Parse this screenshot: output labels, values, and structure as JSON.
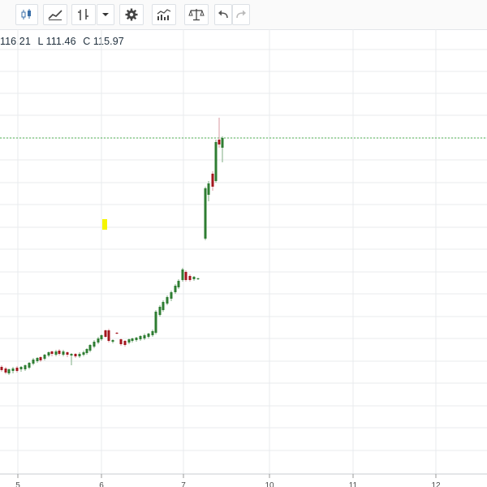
{
  "toolbar": {
    "buttons": [
      {
        "name": "candles-style-button",
        "icon": "candlestick-icon"
      },
      {
        "name": "compare-button",
        "icon": "line-chart-icon"
      },
      {
        "name": "indicators-button",
        "icon": "indicator-icon"
      },
      {
        "name": "indicators-dropdown-button",
        "icon": "chevron-down-icon"
      },
      {
        "name": "settings-button",
        "icon": "gear-icon"
      },
      {
        "name": "volume-button",
        "icon": "bar-chart-icon"
      },
      {
        "name": "compare-scale-button",
        "icon": "scale-icon"
      },
      {
        "name": "undo-button",
        "icon": "undo-icon"
      },
      {
        "name": "redo-button",
        "icon": "redo-icon"
      }
    ]
  },
  "legend": {
    "high": "116.21",
    "low": "L 111.46",
    "close": "C 115.97"
  },
  "colors": {
    "up": "#2e7d32",
    "down": "#a3161d",
    "price_line": "#4caf50",
    "grid": "#e8ebee",
    "marker": "#f5f500"
  },
  "chart_data": {
    "type": "candlestick",
    "x_ticks": [
      "5",
      "6",
      "7",
      "10",
      "11",
      "12"
    ],
    "grid": true,
    "markers": [
      "yellow-marker"
    ]
  }
}
